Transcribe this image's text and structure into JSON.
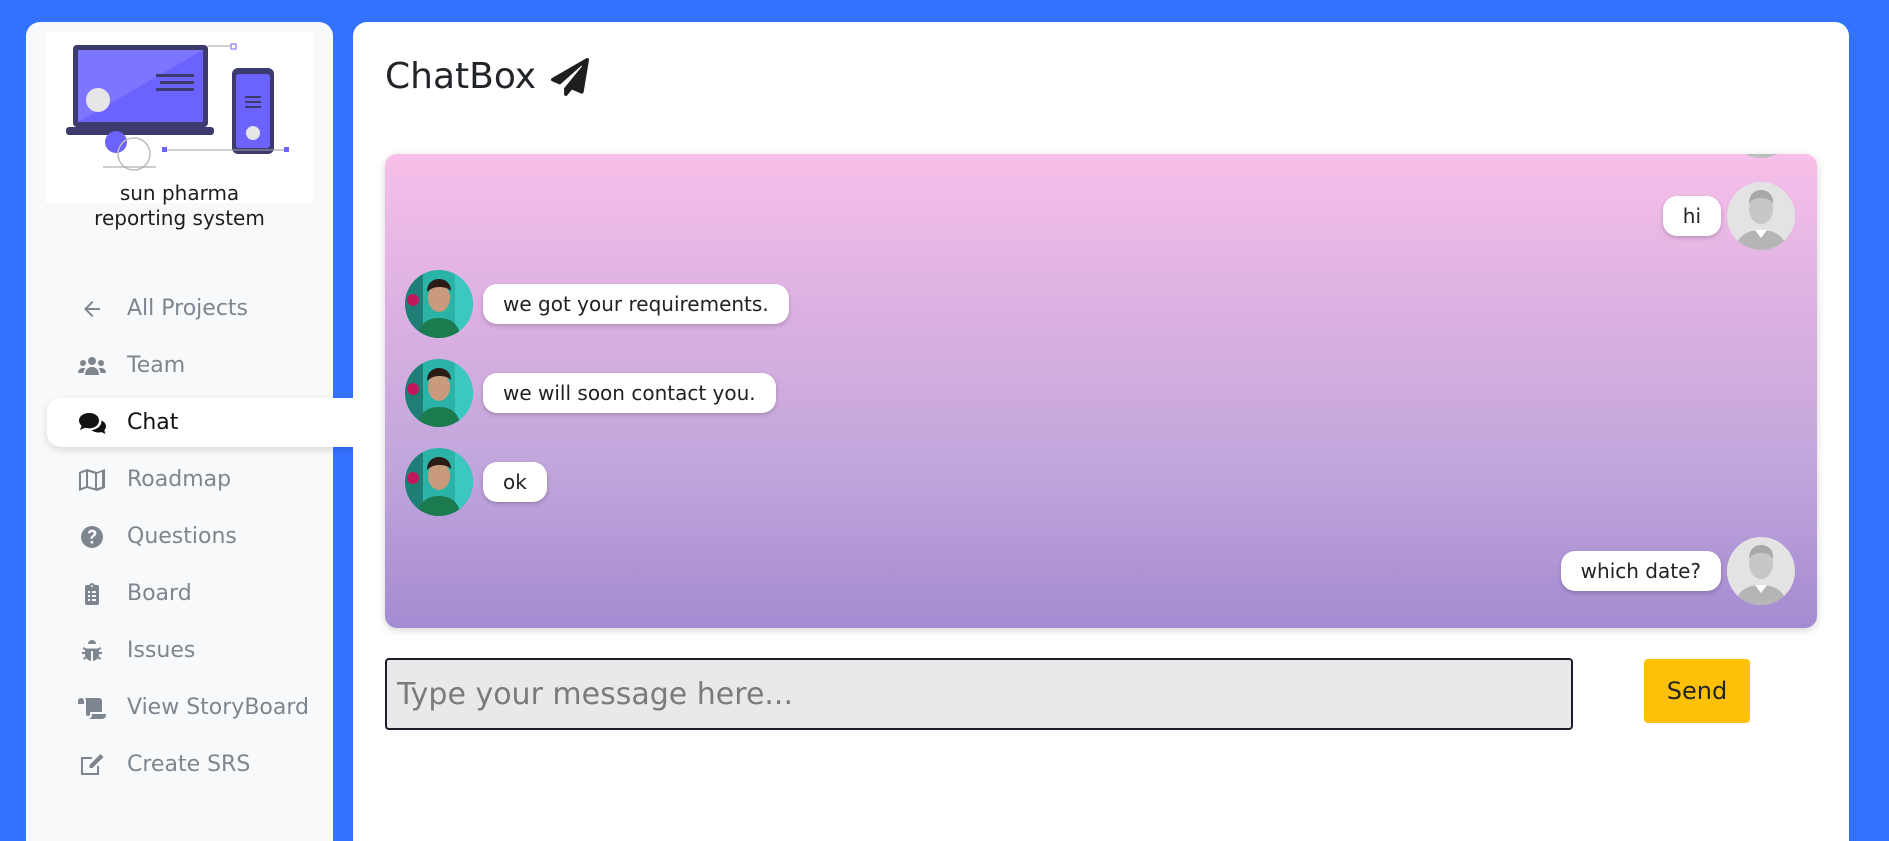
{
  "sidebar": {
    "project_name": "sun pharma reporting system",
    "items": [
      {
        "label": "All Projects",
        "icon": "arrow-left-icon"
      },
      {
        "label": "Team",
        "icon": "users-icon"
      },
      {
        "label": "Chat",
        "icon": "comments-icon",
        "active": true
      },
      {
        "label": "Roadmap",
        "icon": "map-icon"
      },
      {
        "label": "Questions",
        "icon": "question-circle-icon"
      },
      {
        "label": "Board",
        "icon": "clipboard-icon"
      },
      {
        "label": "Issues",
        "icon": "bug-icon"
      },
      {
        "label": "View StoryBoard",
        "icon": "scroll-icon"
      },
      {
        "label": "Create SRS",
        "icon": "edit-icon"
      }
    ]
  },
  "main": {
    "title": "ChatBox",
    "title_icon": "paper-plane-icon",
    "messages": [
      {
        "side": "right",
        "text": "hi",
        "avatar": "default-user-avatar"
      },
      {
        "side": "left",
        "text": "we got your requirements.",
        "avatar": "team-member-avatar"
      },
      {
        "side": "left",
        "text": "we will soon contact you.",
        "avatar": "team-member-avatar"
      },
      {
        "side": "left",
        "text": "ok",
        "avatar": "team-member-avatar"
      },
      {
        "side": "right",
        "text": "which date?",
        "avatar": "default-user-avatar"
      }
    ],
    "input": {
      "placeholder": "Type your message here...",
      "value": ""
    },
    "send_label": "Send"
  },
  "colors": {
    "background": "#3371ff",
    "send_button": "#ffc107",
    "chat_gradient_top": "#f7bfe9",
    "chat_gradient_bottom": "#a48bd1"
  }
}
